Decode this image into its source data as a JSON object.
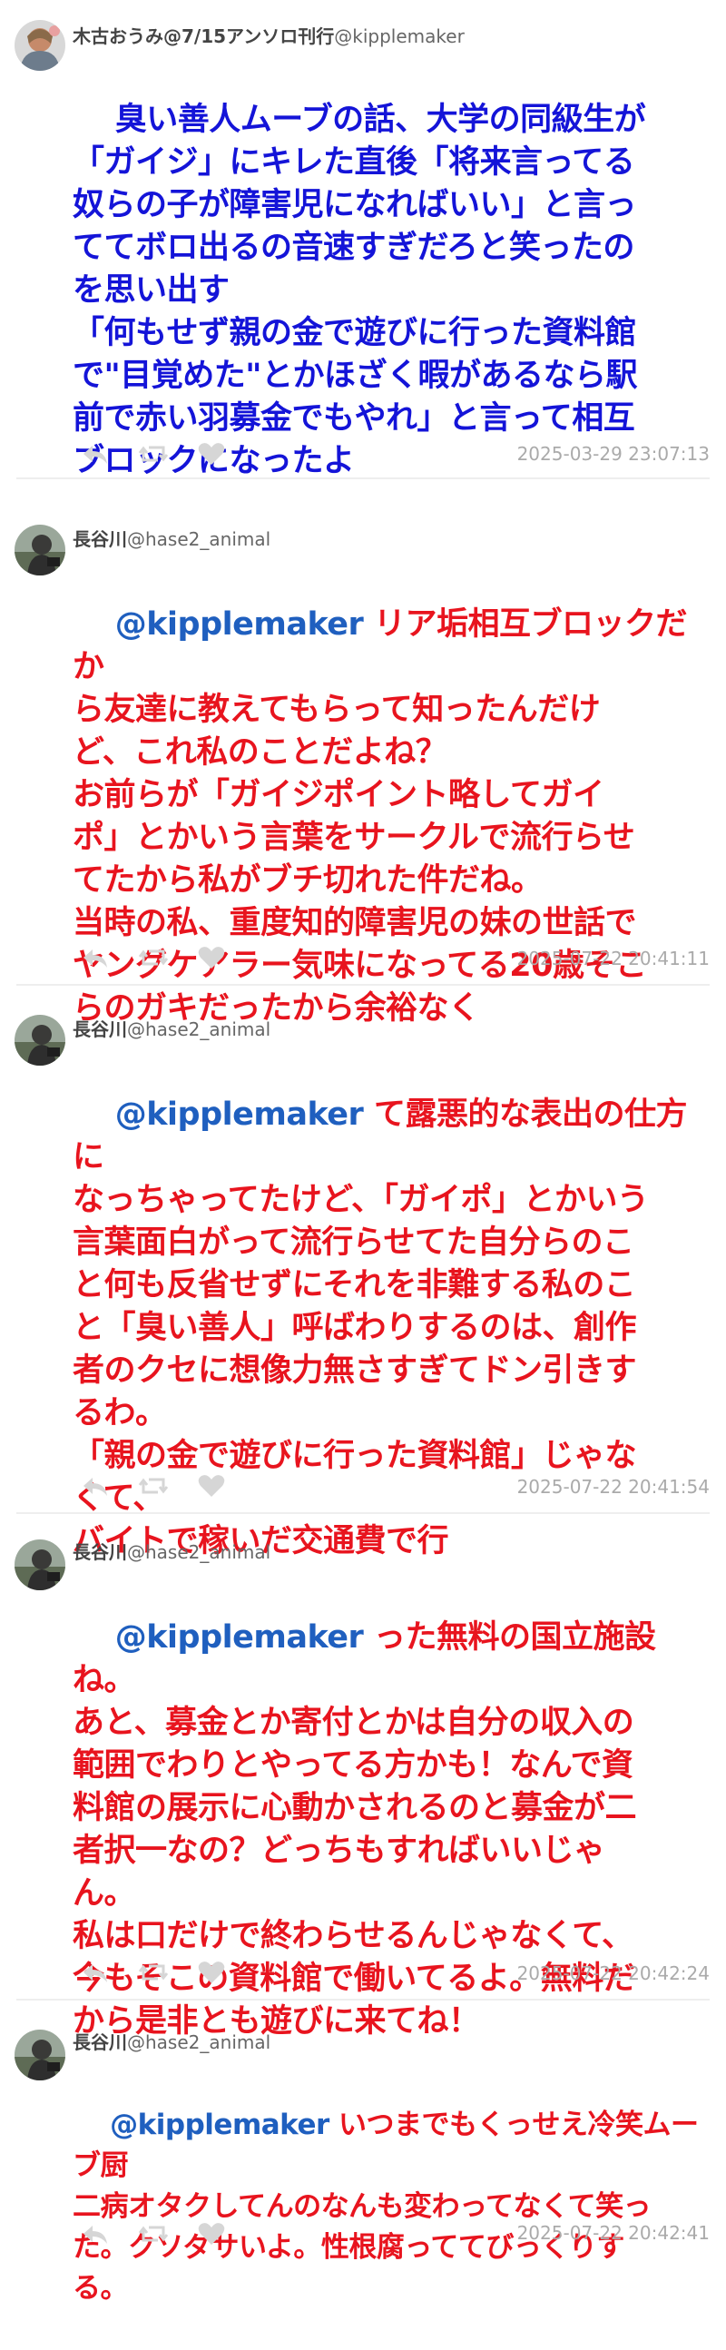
{
  "colors": {
    "op_text": "#1414d8",
    "reply_text": "#e8141e",
    "mention": "#1f5fbf",
    "timestamp": "#aaaaaa"
  },
  "tweets": [
    {
      "display_name": "木古おうみ@7/15アンソロ刊行",
      "handle": "@kipplemaker",
      "mention": "",
      "text": "臭い善人ムーブの話、大学の同級生が\n「ガイジ」にキレた直後「将来言ってる\n奴らの子が障害児になればいい」と言っ\nててボロ出るの音速すぎだろと笑ったの\nを思い出す\n「何もせず親の金で遊びに行った資料館\nで\"目覚めた\"とかほざく暇があるなら駅\n前で赤い羽募金でもやれ」と言って相互\nブロックになったよ",
      "timestamp": "2025-03-29 23:07:13",
      "avatar_icon": "illustrated-avatar-icon"
    },
    {
      "display_name": "長谷川",
      "handle": "@hase2_animal",
      "mention": "@kipplemaker",
      "text": " リア垢相互ブロックだか\nら友達に教えてもらって知ったんだけ\nど、これ私のことだよね？\nお前らが「ガイジポイント略してガイ\nポ」とかいう言葉をサークルで流行らせ\nてたから私がブチ切れた件だね。\n当時の私、重度知的障害児の妹の世話で\nヤングケアラー気味になってる20歳そこ\nらのガキだったから余裕なく",
      "timestamp": "2025-07-22 20:41:11",
      "avatar_icon": "photo-avatar-icon"
    },
    {
      "display_name": "長谷川",
      "handle": "@hase2_animal",
      "mention": "@kipplemaker",
      "text": " て露悪的な表出の仕方に\nなっちゃってたけど、「ガイポ」とかいう\n言葉面白がって流行らせてた自分らのこ\nと何も反省せずにそれを非難する私のこ\nと「臭い善人」呼ばわりするのは、創作\n者のクセに想像力無さすぎてドン引きす\nるわ。\n「親の金で遊びに行った資料館」じゃな\nくて、\nバイトで稼いだ交通費で行",
      "timestamp": "2025-07-22 20:41:54",
      "avatar_icon": "photo-avatar-icon"
    },
    {
      "display_name": "長谷川",
      "handle": "@hase2_animal",
      "mention": "@kipplemaker",
      "text": " った無料の国立施設ね。\nあと、募金とか寄付とかは自分の収入の\n範囲でわりとやってる方かも！なんで資\n料館の展示に心動かされるのと募金が二\n者択一なの？どっちもすればいいじゃ\nん。\n私は口だけで終わらせるんじゃなくて、\n今もそこの資料館で働いてるよ。無料だ\nから是非とも遊びに来てね！",
      "timestamp": "2025-07-22 20:42:24",
      "avatar_icon": "photo-avatar-icon"
    },
    {
      "display_name": "長谷川",
      "handle": "@hase2_animal",
      "mention": "@kipplemaker",
      "text": " いつまでもくっせえ冷笑ムーブ厨\n二病オタクしてんのなんも変わってなくて笑っ\nた。クソダサいよ。性根腐っててびっくりす\nる。",
      "timestamp": "2025-07-22 20:42:41",
      "avatar_icon": "photo-avatar-icon"
    }
  ],
  "action_icons": [
    "reply-icon",
    "retweet-icon",
    "like-icon"
  ]
}
